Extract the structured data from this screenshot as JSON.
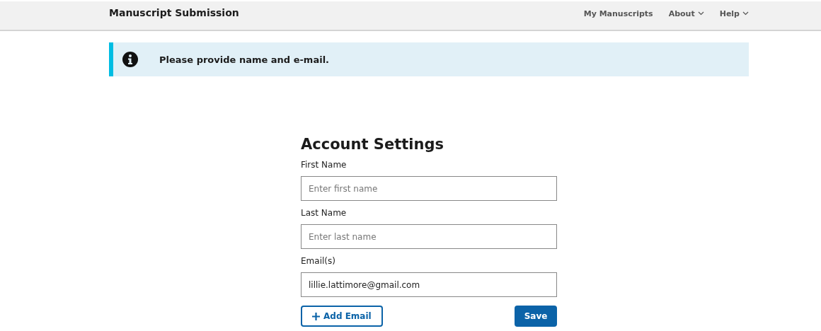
{
  "header": {
    "title": "Manuscript Submission",
    "nav": [
      {
        "label": "My Manuscripts",
        "kind": "link"
      },
      {
        "label": "About",
        "kind": "dropdown"
      },
      {
        "label": "Help",
        "kind": "dropdown"
      }
    ]
  },
  "alert": {
    "message": "Please provide name and e-mail."
  },
  "form": {
    "title": "Account Settings",
    "fields": [
      {
        "label": "First Name",
        "placeholder": "Enter first name"
      },
      {
        "label": "Last Name",
        "placeholder": "Enter last name"
      },
      {
        "label": "Email(s)",
        "value": "lillie.lattimore@gmail.com"
      }
    ],
    "buttons": [
      {
        "label": "Add Email",
        "kind": "add"
      },
      {
        "label": "Save",
        "kind": "primary"
      }
    ]
  }
}
